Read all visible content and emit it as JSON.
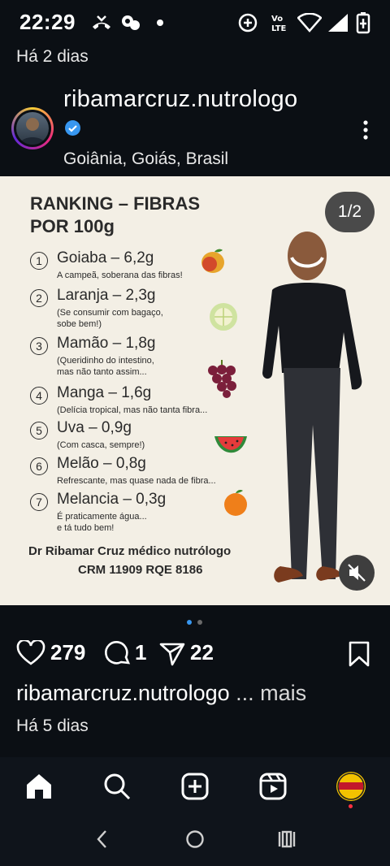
{
  "status_bar": {
    "time": "22:29"
  },
  "post": {
    "time_ago_top": "Há 2 dias",
    "username": "ribamarcruz.nutrologo",
    "location": "Goiânia, Goiás, Brasil",
    "page_indicator": "1/2",
    "image": {
      "title_line1": "RANKING – FIBRAS",
      "title_line2": "POR 100g",
      "items": [
        {
          "num": "1",
          "name": "Goiaba – 6,2g",
          "desc": [
            "A campeã, soberana das fibras!"
          ],
          "icon": "guava-icon"
        },
        {
          "num": "2",
          "name": "Laranja – 2,3g",
          "desc": [
            "(Se consumir com bagaço,",
            "sobe bem!)"
          ],
          "icon": "melon-slice-icon"
        },
        {
          "num": "3",
          "name": "Mamão – 1,8g",
          "desc": [
            "(Queridinho do intestino,",
            "mas não tanto assim..."
          ],
          "icon": "grapes-icon"
        },
        {
          "num": "4",
          "name": "Manga – 1,6g",
          "desc": [
            "(Delícia tropical, mas não tanta fibra..."
          ],
          "icon": ""
        },
        {
          "num": "5",
          "name": "Uva – 0,9g",
          "desc": [
            "(Com casca, sempre!)"
          ],
          "icon": "watermelon-icon"
        },
        {
          "num": "6",
          "name": "Melão – 0,8g",
          "desc": [
            "Refrescante, mas quase nada de fibra..."
          ],
          "icon": ""
        },
        {
          "num": "7",
          "name": "Melancia – 0,3g",
          "desc": [
            "É praticamente água...",
            "e tá tudo bem!"
          ],
          "icon": "orange-icon"
        }
      ],
      "doctor_name": "Dr Ribamar Cruz médico nutrólogo",
      "doctor_crm": "CRM 11909 RQE 8186"
    },
    "likes": "279",
    "comments": "1",
    "shares": "22",
    "caption_user": "ribamarcruz.nutrologo",
    "caption_more": "... mais",
    "time_ago_bottom": "Há 5 dias"
  },
  "colors": {
    "background": "#0b0f14",
    "post_bg": "#f3efe5",
    "verified": "#3897f0",
    "carousel_active": "#3897f0"
  }
}
